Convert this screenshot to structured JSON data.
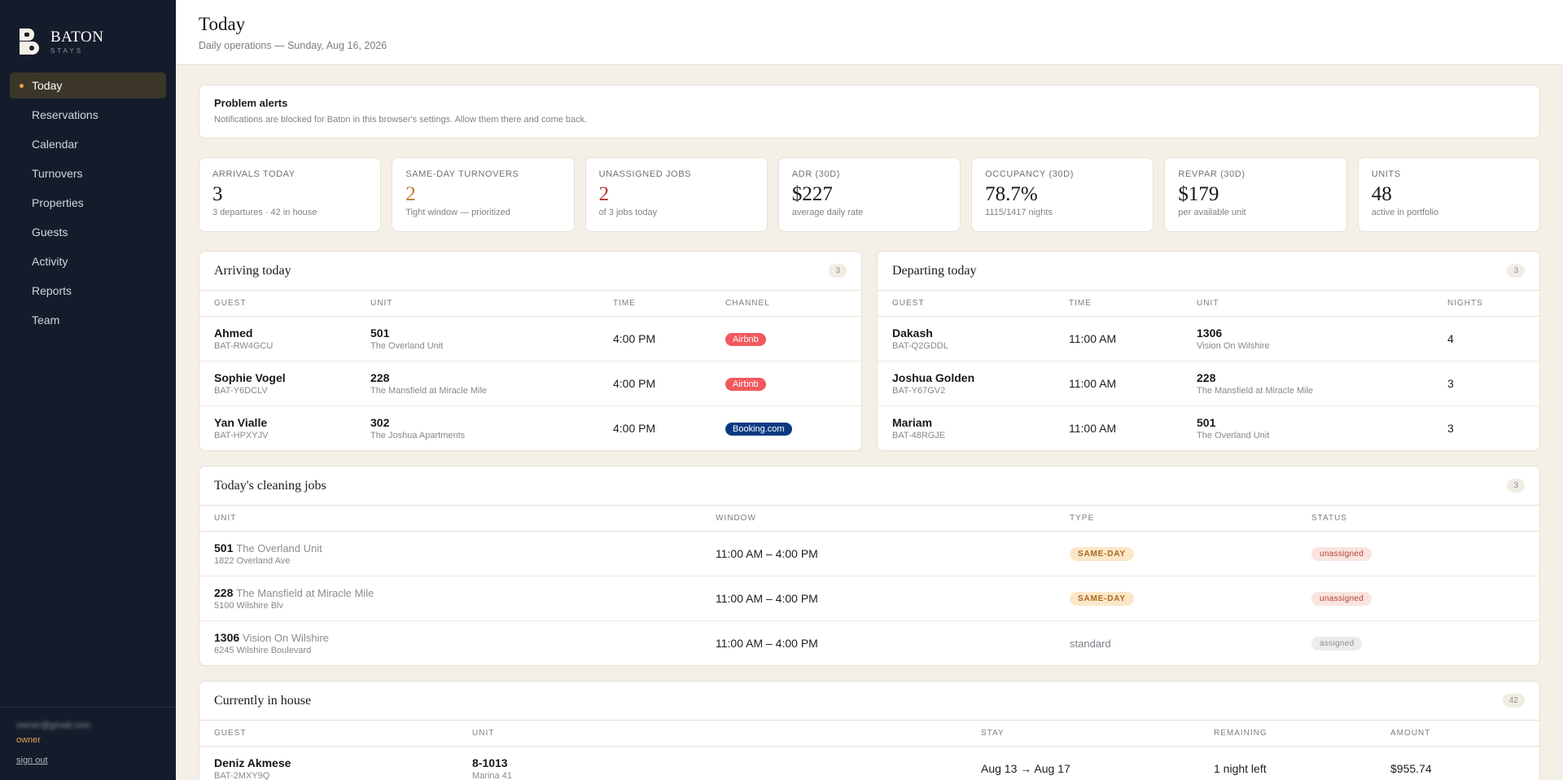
{
  "brand": {
    "name": "BATON",
    "tagline": "STAYS"
  },
  "nav": [
    {
      "label": "Today",
      "active": true
    },
    {
      "label": "Reservations"
    },
    {
      "label": "Calendar"
    },
    {
      "label": "Turnovers"
    },
    {
      "label": "Properties"
    },
    {
      "label": "Guests"
    },
    {
      "label": "Activity"
    },
    {
      "label": "Reports"
    },
    {
      "label": "Team"
    }
  ],
  "user": {
    "email": "owner@gmail.com",
    "role": "owner",
    "signout": "sign out"
  },
  "header": {
    "title": "Today",
    "subtitle": "Daily operations — Sunday, Aug 16, 2026"
  },
  "alert": {
    "title": "Problem alerts",
    "message": "Notifications are blocked for Baton in this browser's settings. Allow them there and come back."
  },
  "stats": [
    {
      "label": "ARRIVALS TODAY",
      "value": "3",
      "caption": "3 departures · 42 in house",
      "tone": "default"
    },
    {
      "label": "SAME-DAY TURNOVERS",
      "value": "2",
      "caption": "Tight window — prioritized",
      "tone": "orange"
    },
    {
      "label": "UNASSIGNED JOBS",
      "value": "2",
      "caption": "of 3 jobs today",
      "tone": "red"
    },
    {
      "label": "ADR (30D)",
      "value": "$227",
      "caption": "average daily rate",
      "tone": "default"
    },
    {
      "label": "OCCUPANCY (30D)",
      "value": "78.7%",
      "caption": "1115/1417 nights",
      "tone": "default"
    },
    {
      "label": "REVPAR (30D)",
      "value": "$179",
      "caption": "per available unit",
      "tone": "default"
    },
    {
      "label": "UNITS",
      "value": "48",
      "caption": "active in portfolio",
      "tone": "default"
    }
  ],
  "arriving": {
    "title": "Arriving today",
    "count": "3",
    "columns": [
      "GUEST",
      "UNIT",
      "TIME",
      "CHANNEL"
    ],
    "rows": [
      {
        "guest": "Ahmed",
        "code": "BAT-RW4GCU",
        "unit": "501",
        "unit_name": "The Overland Unit",
        "time": "4:00 PM",
        "channel": "Airbnb",
        "channel_type": "airbnb"
      },
      {
        "guest": "Sophie Vogel",
        "code": "BAT-Y6DCLV",
        "unit": "228",
        "unit_name": "The Mansfield at Miracle Mile",
        "time": "4:00 PM",
        "channel": "Airbnb",
        "channel_type": "airbnb"
      },
      {
        "guest": "Yan Vialle",
        "code": "BAT-HPXYJV",
        "unit": "302",
        "unit_name": "The Joshua Apartments",
        "time": "4:00 PM",
        "channel": "Booking.com",
        "channel_type": "booking"
      }
    ]
  },
  "departing": {
    "title": "Departing today",
    "count": "3",
    "columns": [
      "GUEST",
      "TIME",
      "UNIT",
      "NIGHTS"
    ],
    "rows": [
      {
        "guest": "Dakash",
        "code": "BAT-Q2GDDL",
        "time": "11:00 AM",
        "unit": "1306",
        "unit_name": "Vision On Wilshire",
        "nights": "4"
      },
      {
        "guest": "Joshua Golden",
        "code": "BAT-Y67GV2",
        "time": "11:00 AM",
        "unit": "228",
        "unit_name": "The Mansfield at Miracle Mile",
        "nights": "3"
      },
      {
        "guest": "Mariam",
        "code": "BAT-48RGJE",
        "time": "11:00 AM",
        "unit": "501",
        "unit_name": "The Overland Unit",
        "nights": "3"
      }
    ]
  },
  "cleaning": {
    "title": "Today's cleaning jobs",
    "count": "3",
    "columns": [
      "UNIT",
      "WINDOW",
      "TYPE",
      "STATUS"
    ],
    "rows": [
      {
        "unit": "501",
        "unit_name": "The Overland Unit",
        "address": "1822 Overland Ave",
        "window": "11:00 AM – 4:00 PM",
        "type": "SAME-DAY",
        "type_style": "sameday",
        "status": "unassigned"
      },
      {
        "unit": "228",
        "unit_name": "The Mansfield at Miracle Mile",
        "address": "5100 Wilshire Blv",
        "window": "11:00 AM – 4:00 PM",
        "type": "SAME-DAY",
        "type_style": "sameday",
        "status": "unassigned"
      },
      {
        "unit": "1306",
        "unit_name": "Vision On Wilshire",
        "address": "6245 Wilshire Boulevard",
        "window": "11:00 AM – 4:00 PM",
        "type": "standard",
        "type_style": "standard",
        "status": "assigned"
      }
    ]
  },
  "inhouse": {
    "title": "Currently in house",
    "count": "42",
    "columns": [
      "GUEST",
      "UNIT",
      "STAY",
      "REMAINING",
      "AMOUNT"
    ],
    "rows": [
      {
        "guest": "Deniz Akmese",
        "code": "BAT-2MXY9Q",
        "unit": "8-1013",
        "unit_name": "Marina 41",
        "stay": "Aug 13 → Aug 17",
        "remaining": "1 night left",
        "amount": "$955.74"
      }
    ]
  }
}
